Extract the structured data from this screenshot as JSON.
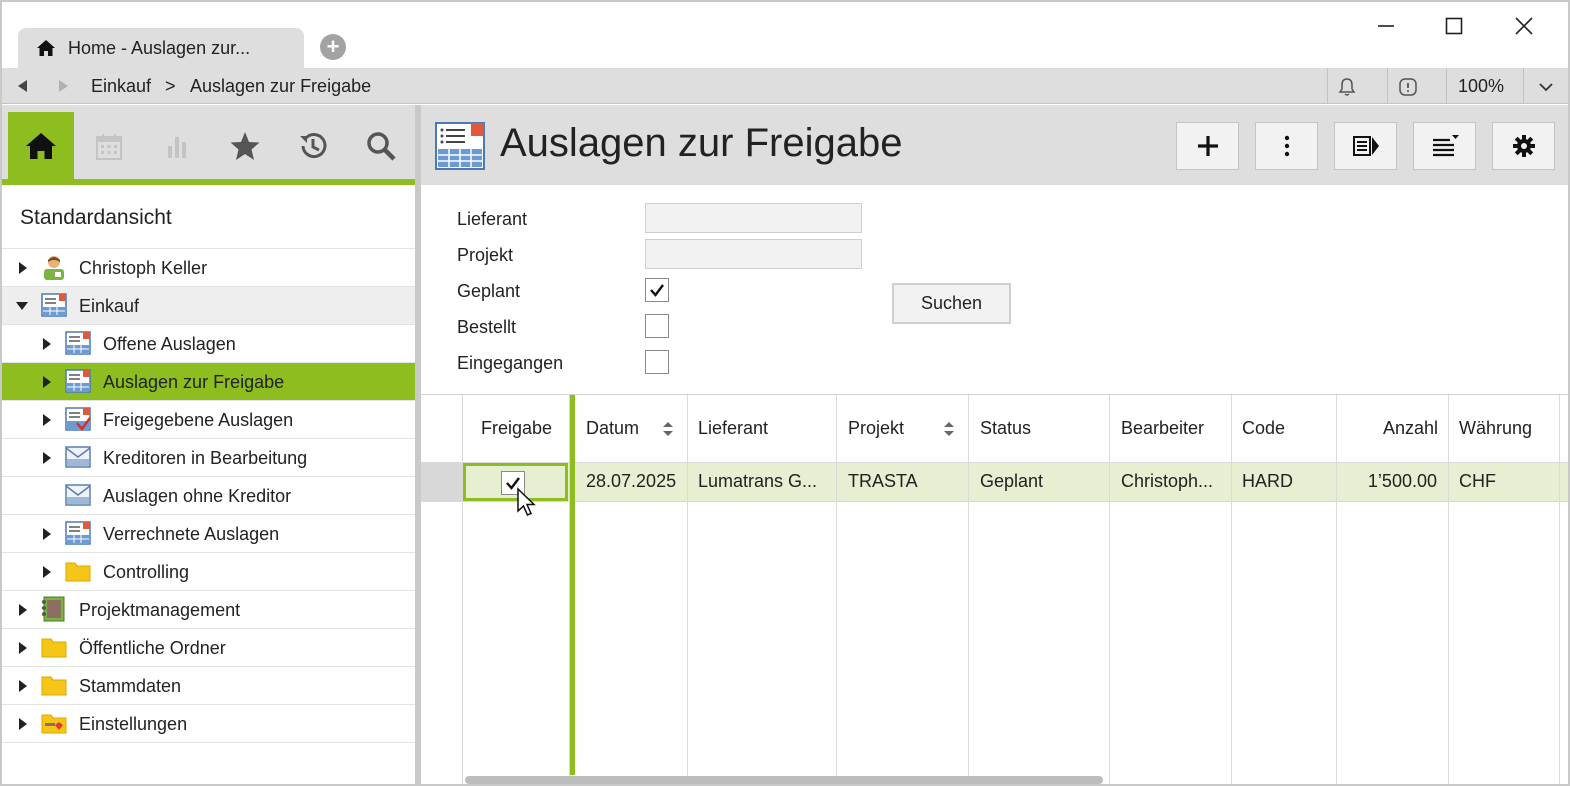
{
  "tab": {
    "title": "Home - Auslagen zur..."
  },
  "breadcrumb": {
    "items": [
      "Einkauf",
      ">",
      "Auslagen zur Freigabe"
    ]
  },
  "zoom": "100%",
  "sidebar": {
    "view_title": "Standardansicht",
    "tree": [
      {
        "label": "Christoph Keller",
        "level": 0,
        "expander": "collapsed",
        "icon": "user-icon"
      },
      {
        "label": "Einkauf",
        "level": 0,
        "expander": "expanded",
        "icon": "list-card-icon"
      },
      {
        "label": "Offene Auslagen",
        "level": 1,
        "expander": "collapsed",
        "icon": "list-card-icon"
      },
      {
        "label": "Auslagen zur Freigabe",
        "level": 1,
        "expander": "collapsed",
        "icon": "list-card-icon",
        "selected": true
      },
      {
        "label": "Freigegebene Auslagen",
        "level": 1,
        "expander": "collapsed",
        "icon": "list-check-icon"
      },
      {
        "label": "Kreditoren in Bearbeitung",
        "level": 1,
        "expander": "collapsed",
        "icon": "envelope-card-icon"
      },
      {
        "label": "Auslagen ohne Kreditor",
        "level": 1,
        "expander": "none",
        "icon": "envelope-card-icon"
      },
      {
        "label": "Verrechnete Auslagen",
        "level": 1,
        "expander": "collapsed",
        "icon": "list-card-icon"
      },
      {
        "label": "Controlling",
        "level": 1,
        "expander": "collapsed",
        "icon": "folder-icon"
      },
      {
        "label": "Projektmanagement",
        "level": 0,
        "expander": "collapsed",
        "icon": "notebook-icon"
      },
      {
        "label": "Öffentliche Ordner",
        "level": 0,
        "expander": "collapsed",
        "icon": "folder-icon"
      },
      {
        "label": "Stammdaten",
        "level": 0,
        "expander": "collapsed",
        "icon": "folder-icon"
      },
      {
        "label": "Einstellungen",
        "level": 0,
        "expander": "collapsed",
        "icon": "settings-folder-icon"
      }
    ]
  },
  "main": {
    "title": "Auslagen zur Freigabe",
    "filters": {
      "lieferant_label": "Lieferant",
      "lieferant_value": "",
      "projekt_label": "Projekt",
      "projekt_value": "",
      "geplant_label": "Geplant",
      "geplant_checked": true,
      "bestellt_label": "Bestellt",
      "bestellt_checked": false,
      "eingegangen_label": "Eingegangen",
      "eingegangen_checked": false,
      "search_button": "Suchen"
    },
    "grid": {
      "columns": [
        "Freigabe",
        "Datum",
        "Lieferant",
        "Projekt",
        "Status",
        "Bearbeiter",
        "Code",
        "Anzahl",
        "Währung"
      ],
      "rows": [
        {
          "freigabe": true,
          "datum": "28.07.2025",
          "lieferant": "Lumatrans G...",
          "projekt": "TRASTA",
          "status": "Geplant",
          "bearbeiter": "Christoph...",
          "code": "HARD",
          "anzahl": "1’500.00",
          "waehrung": "CHF"
        }
      ]
    }
  },
  "colors": {
    "accent": "#8dbd1e",
    "selected_row": "#e6efd2",
    "chrome": "#dedede"
  }
}
